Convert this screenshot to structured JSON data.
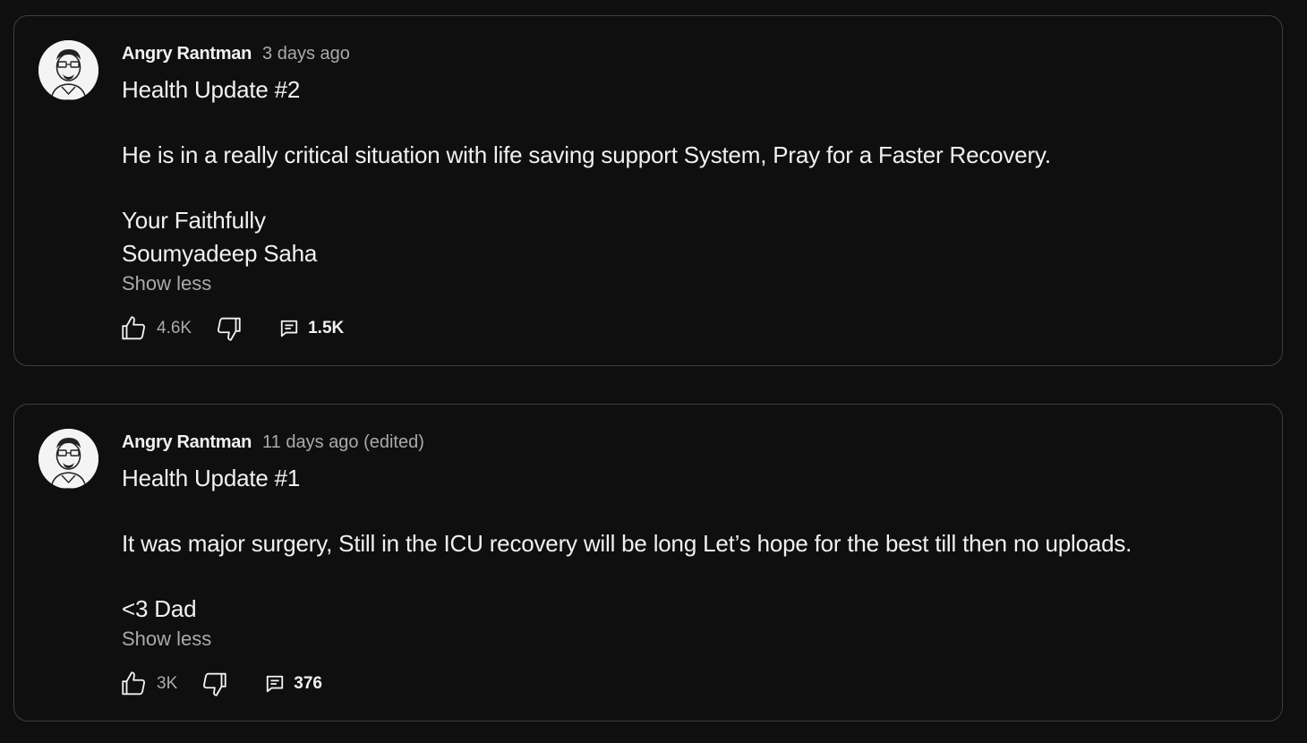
{
  "posts": [
    {
      "author": "Angry Rantman",
      "time": "3 days ago",
      "body": "Health Update #2\n\nHe is in a really critical situation with life saving support System, Pray for a Faster Recovery.\n\nYour Faithfully\nSoumyadeep Saha",
      "show_less": "Show less",
      "likes": "4.6K",
      "comments": "1.5K"
    },
    {
      "author": "Angry Rantman",
      "time": "11 days ago (edited)",
      "body": "Health Update #1\n\nIt was major surgery, Still in the ICU recovery will be long Let’s hope for the best till then no uploads.\n\n<3 Dad",
      "show_less": "Show less",
      "likes": "3K",
      "comments": "376"
    }
  ],
  "icons": {
    "like": "thumbs-up-icon",
    "dislike": "thumbs-down-icon",
    "comment": "comment-icon"
  },
  "colors": {
    "background": "#0f0f0f",
    "border": "#3e3e3e",
    "text_primary": "#f1f1f1",
    "text_secondary": "#aaaaaa"
  }
}
